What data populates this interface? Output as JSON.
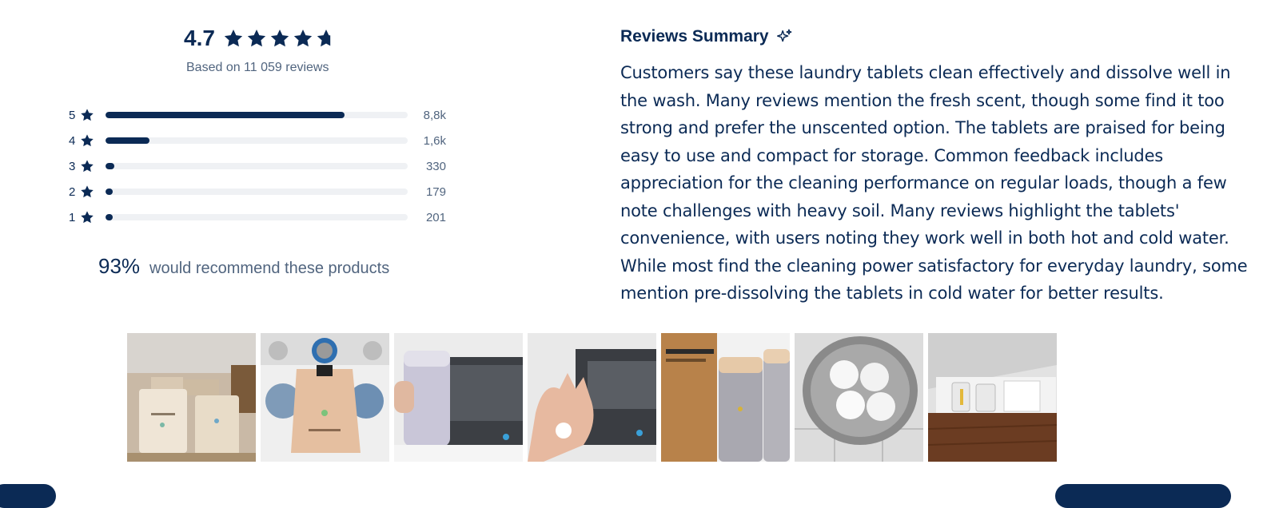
{
  "rating": {
    "average": "4.7",
    "stars_value": 4.7,
    "based_on": "Based on 11 059 reviews",
    "distribution": [
      {
        "stars": "5",
        "count": "8,8k",
        "fraction": 0.79
      },
      {
        "stars": "4",
        "count": "1,6k",
        "fraction": 0.145
      },
      {
        "stars": "3",
        "count": "330",
        "fraction": 0.03
      },
      {
        "stars": "2",
        "count": "179",
        "fraction": 0.016
      },
      {
        "stars": "1",
        "count": "201",
        "fraction": 0.018
      }
    ],
    "recommend_pct": "93%",
    "recommend_text": "would recommend these products"
  },
  "summary": {
    "title": "Reviews Summary",
    "lines": [
      "Customers say these laundry tablets clean effectively and dissolve well in",
      "the wash. Many reviews mention the fresh scent, though some find it too",
      "strong and prefer the unscented option. The tablets are praised for being",
      "easy to use and compact for storage. Common feedback includes",
      "appreciation for the cleaning performance on regular loads, though a few",
      "note challenges with heavy soil. Many reviews highlight the tablets'",
      "convenience, with users noting they work well in both hot and cold water.",
      "While most find the cleaning power satisfactory for everyday laundry, some",
      "mention pre-dissolving the tablets in cold water for better results."
    ]
  },
  "theme": {
    "navy": "#0b2a55",
    "muted": "#51657f",
    "track": "#eff1f4"
  },
  "icons": {
    "rating_star": "star-icon",
    "summary_sparkle": "sparkle-icon"
  }
}
